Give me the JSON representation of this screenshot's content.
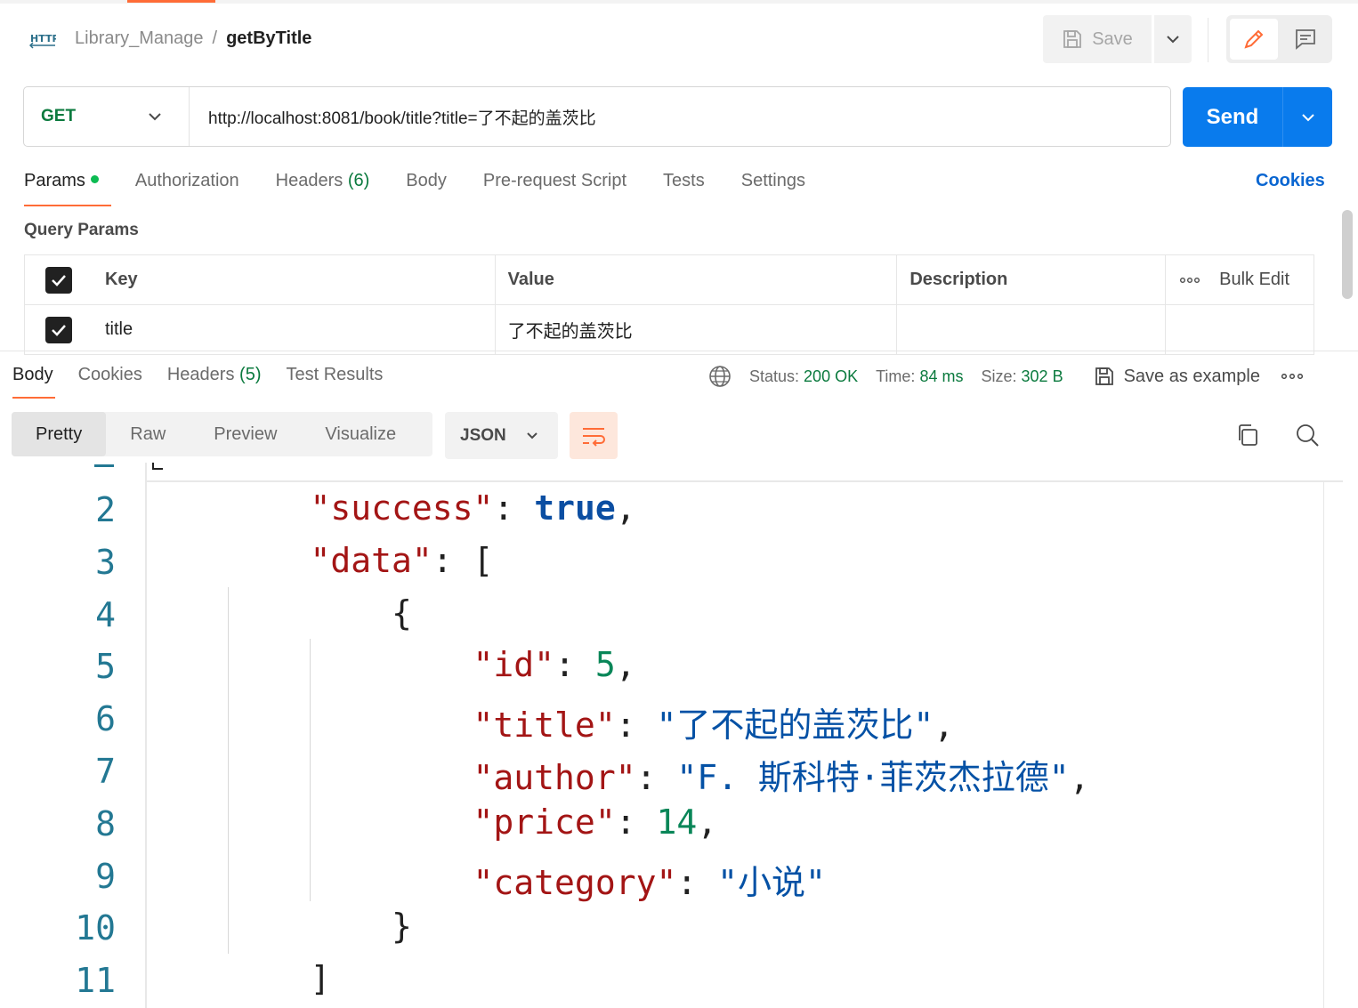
{
  "header": {
    "collection": "Library_Manage",
    "separator": "/",
    "request_name": "getByTitle",
    "save_label": "Save"
  },
  "request": {
    "method": "GET",
    "url": "http://localhost:8081/book/title?title=了不起的盖茨比",
    "send_label": "Send"
  },
  "request_tabs": {
    "params": "Params",
    "authorization": "Authorization",
    "headers": "Headers",
    "headers_count": "(6)",
    "body": "Body",
    "prerequest": "Pre-request Script",
    "tests": "Tests",
    "settings": "Settings",
    "cookies": "Cookies"
  },
  "query_params": {
    "title": "Query Params",
    "columns": {
      "key": "Key",
      "value": "Value",
      "description": "Description",
      "bulk_edit": "Bulk Edit"
    },
    "rows": [
      {
        "key": "title",
        "value": "了不起的盖茨比",
        "description": "",
        "checked": true
      }
    ]
  },
  "response_tabs": {
    "body": "Body",
    "cookies": "Cookies",
    "headers": "Headers",
    "headers_count": "(5)",
    "test_results": "Test Results"
  },
  "response_meta": {
    "status_label": "Status:",
    "status_value": "200 OK",
    "time_label": "Time:",
    "time_value": "84 ms",
    "size_label": "Size:",
    "size_value": "302 B",
    "save_example": "Save as example"
  },
  "format_toolbar": {
    "pretty": "Pretty",
    "raw": "Raw",
    "preview": "Preview",
    "visualize": "Visualize",
    "language": "JSON"
  },
  "response_body": {
    "line_numbers": [
      "2",
      "3",
      "4",
      "5",
      "6",
      "7",
      "8",
      "9",
      "10",
      "11"
    ],
    "success_key": "\"success\"",
    "success_value": "true",
    "data_key": "\"data\"",
    "id_key": "\"id\"",
    "id_value": "5",
    "title_key": "\"title\"",
    "title_value": "\"了不起的盖茨比\"",
    "author_key": "\"author\"",
    "author_value": "\"F. 斯科特·菲茨杰拉德\"",
    "price_key": "\"price\"",
    "price_value": "14",
    "category_key": "\"category\"",
    "category_value": "\"小说\""
  },
  "colors": {
    "accent": "#ff6c37",
    "send": "#097bed",
    "method_get": "#0b7a3e",
    "json_key": "#a31515",
    "json_string": "#0451a5",
    "json_number": "#098658"
  }
}
